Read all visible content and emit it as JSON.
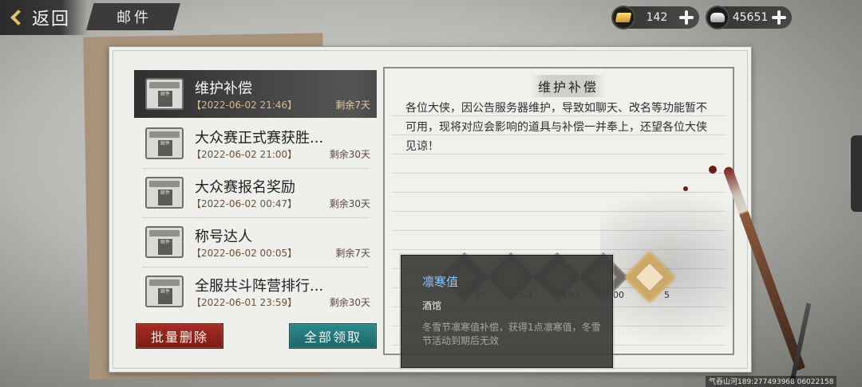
{
  "header": {
    "back_label": "返回",
    "title": "邮件"
  },
  "currency": {
    "gold": {
      "icon": "gold-ingot-icon",
      "value": "142"
    },
    "silver": {
      "icon": "silver-ingot-icon",
      "value": "45651"
    }
  },
  "mail_icon_text": "邮件",
  "mails": [
    {
      "title": "维护补偿",
      "date": "【2022-06-02 21:46】",
      "remain": "剩余7天",
      "selected": true
    },
    {
      "title": "大众赛正式赛获胜...",
      "date": "【2022-06-02 21:00】",
      "remain": "剩余30天",
      "selected": false
    },
    {
      "title": "大众赛报名奖励",
      "date": "【2022-06-02 00:47】",
      "remain": "剩余30天",
      "selected": false
    },
    {
      "title": "称号达人",
      "date": "【2022-06-02 00:05】",
      "remain": "剩余7天",
      "selected": false
    },
    {
      "title": "全服共斗阵营排行...",
      "date": "【2022-06-01 23:59】",
      "remain": "剩余30天",
      "selected": false
    }
  ],
  "buttons": {
    "batch_delete": "批量删除",
    "claim_all": "全部领取"
  },
  "detail": {
    "title": "维护补偿",
    "body": "各位大侠，因公告服务器维护，导致如聊天、改名等功能暂不可用，现将对应会影响的道具与补偿一并奉上，还望各位大侠见谅！"
  },
  "rewards": [
    {
      "count": "50"
    },
    {
      "count": "50"
    },
    {
      "count": "100"
    },
    {
      "count": "00"
    },
    {
      "count": "5"
    }
  ],
  "tooltip": {
    "name": "凛寒值",
    "source": "酒馆",
    "description": "冬雪节凛寒值补偿，获得1点凛寒值，冬雪节活动到期后无效"
  },
  "watermark": "气吞山河189:277493968 06022158"
}
